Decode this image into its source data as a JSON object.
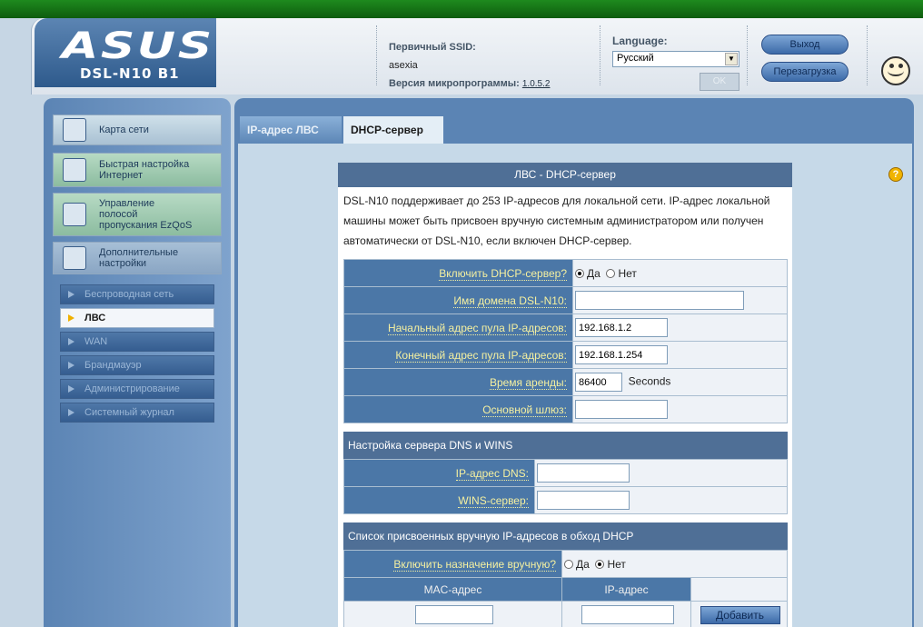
{
  "header": {
    "logo": "ASUS",
    "model": "DSL-N10 B1",
    "ssid_label": "Первичный SSID:",
    "ssid_value": "asexia",
    "firmware_label": "Версия микропрограммы:",
    "firmware_value": "1.0.5.2",
    "language_label": "Language:",
    "language_value": "Русский",
    "ok_label": "OK",
    "logout_label": "Выход",
    "reboot_label": "Перезагрузка"
  },
  "sidebar": {
    "main": [
      {
        "label": "Карта сети",
        "icon": "network-map-icon"
      },
      {
        "label": "Быстрая настройка Интернет",
        "icon": "router-icon"
      },
      {
        "label": "Управление полосой пропускания EzQoS",
        "icon": "qos-icon"
      },
      {
        "label": "Дополнительные настройки",
        "icon": "tools-icon"
      }
    ],
    "sub": [
      {
        "label": "Беспроводная сеть",
        "active": false
      },
      {
        "label": "ЛВС",
        "active": true
      },
      {
        "label": "WAN",
        "active": false
      },
      {
        "label": "Брандмауэр",
        "active": false
      },
      {
        "label": "Администрирование",
        "active": false
      },
      {
        "label": "Системный журнал",
        "active": false
      }
    ]
  },
  "tabs": [
    {
      "label": "IP-адрес ЛВС",
      "active": false
    },
    {
      "label": "DHCP-сервер",
      "active": true
    }
  ],
  "form": {
    "title": "ЛВС - DHCP-сервер",
    "description": "DSL-N10 поддерживает до 253 IP-адресов для локальной сети. IP-адрес локальной машины может быть присвоен вручную системным администратором или получен автоматически от DSL-N10, если включен DHCP-сервер.",
    "enable_label": "Включить DHCP-сервер?",
    "yes": "Да",
    "no": "Нет",
    "domain_label": "Имя домена DSL-N10:",
    "domain_value": "",
    "pool_start_label": "Начальный адрес пула IP-адресов:",
    "pool_start_value": "192.168.1.2",
    "pool_end_label": "Конечный адрес пула IP-адресов:",
    "pool_end_value": "192.168.1.254",
    "lease_label": "Время аренды:",
    "lease_value": "86400",
    "lease_unit": "Seconds",
    "gateway_label": "Основной шлюз:",
    "gateway_value": "",
    "dns_section_title": "Настройка сервера DNS и WINS",
    "dns_label": "IP-адрес DNS:",
    "dns_value": "",
    "wins_label": "WINS-сервер:",
    "wins_value": "",
    "manual_section_title": "Список присвоенных вручную IP-адресов в обход DHCP",
    "manual_enable_label": "Включить назначение вручную?",
    "mac_col": "MAC-адрес",
    "ip_col": "IP-адрес",
    "add_label": "Добавить",
    "dhcp_enabled": true,
    "manual_enabled": false
  }
}
